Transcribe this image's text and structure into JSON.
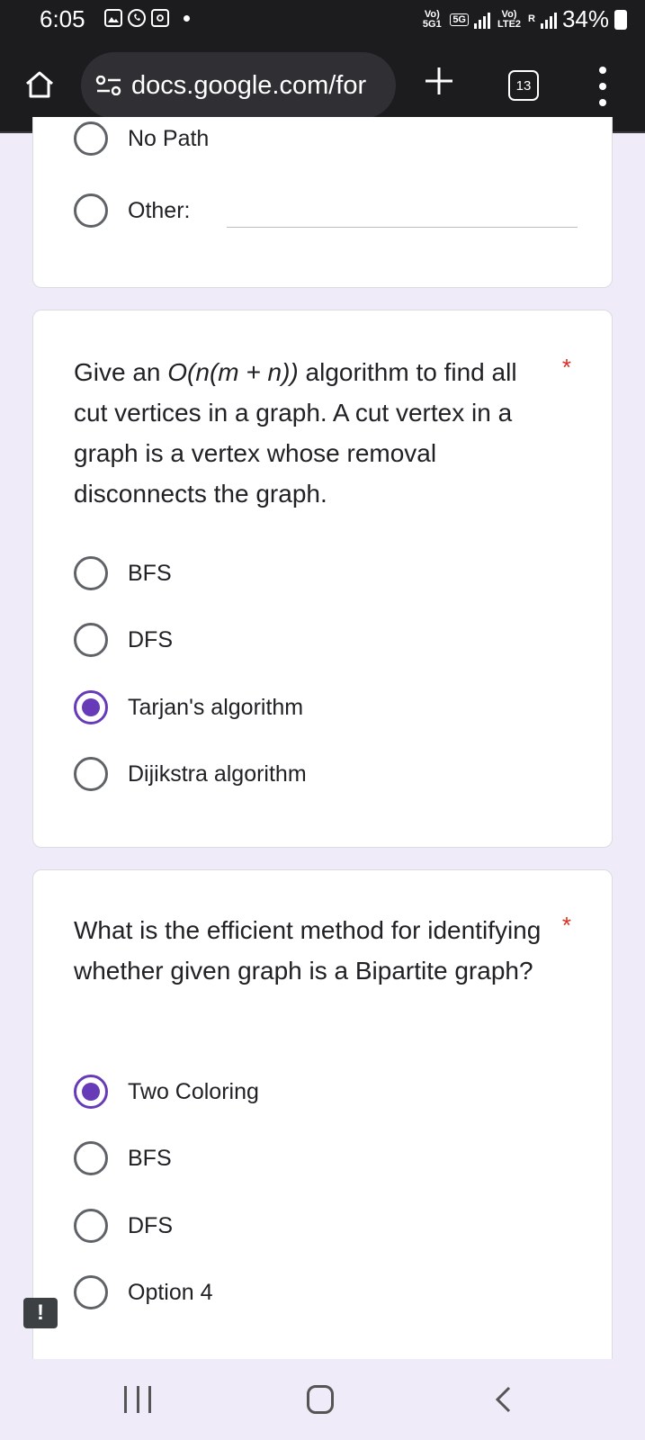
{
  "status_bar": {
    "time": "6:05",
    "sim1_tag": "Vo) 5G1",
    "network_5g": "5G",
    "sim2_tag": "Vo) LTE2",
    "roaming": "R",
    "battery_percent": "34%"
  },
  "browser": {
    "url": "docs.google.com/for",
    "tab_count": "13"
  },
  "previous_question": {
    "options": [
      {
        "label": "No Path",
        "selected": false
      },
      {
        "label": "Other:",
        "selected": false
      }
    ]
  },
  "question_cut_vertices": {
    "text_prefix": "Give an ",
    "text_math": "O(n(m + n))",
    "text_suffix": " algorithm to find all cut vertices in a graph. A cut vertex in a graph is a vertex whose removal disconnects the graph.",
    "required_mark": "*",
    "options": [
      {
        "label": "BFS",
        "selected": false
      },
      {
        "label": "DFS",
        "selected": false
      },
      {
        "label": "Tarjan's algorithm",
        "selected": true
      },
      {
        "label": "Dijikstra algorithm",
        "selected": false
      }
    ]
  },
  "question_bipartite": {
    "text": "What is the efficient method for identifying whether given graph is a Bipartite graph?",
    "required_mark": "*",
    "options": [
      {
        "label": "Two Coloring",
        "selected": true
      },
      {
        "label": "BFS",
        "selected": false
      },
      {
        "label": "DFS",
        "selected": false
      },
      {
        "label": "Option 4",
        "selected": false
      }
    ]
  },
  "report_button": "!",
  "colors": {
    "accent": "#673ab7",
    "page_background": "#efebf8",
    "required": "#d93025",
    "browser_chrome": "#1c1c1e"
  }
}
